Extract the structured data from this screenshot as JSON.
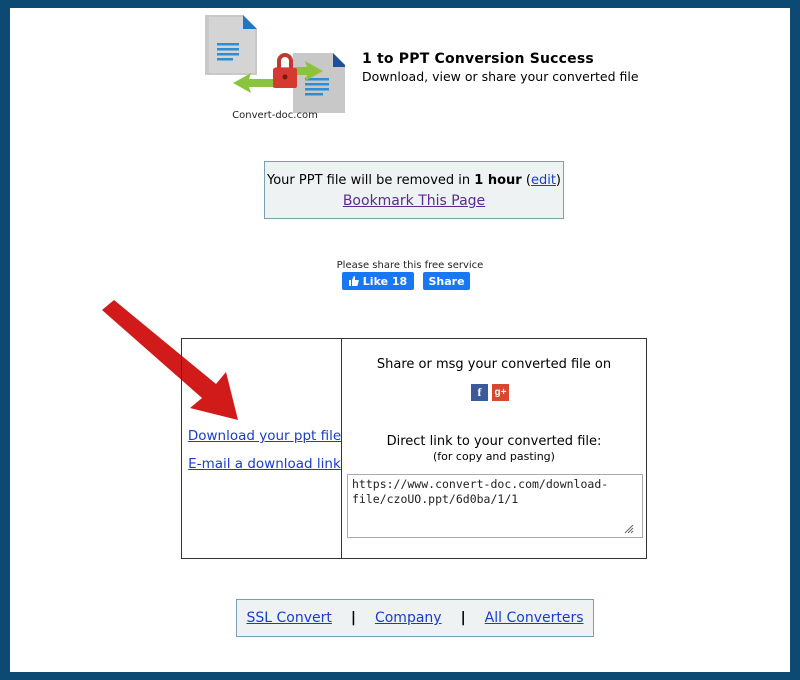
{
  "header": {
    "logo_caption": "Convert-doc.com",
    "title": "1 to PPT Conversion Success",
    "subtitle": "Download, view or share your converted file"
  },
  "info": {
    "prefix": "Your PPT file will be removed in",
    "duration": "1 hour",
    "open_paren": "(",
    "edit_label": "edit",
    "close_paren": ")",
    "bookmark_label": "Bookmark This Page"
  },
  "share_service": {
    "label": "Please share this free service",
    "like_label": "Like 18",
    "share_label": "Share"
  },
  "downloads": {
    "download_label": "Download your ppt file",
    "email_label": "E-mail a download link"
  },
  "share_panel": {
    "title": "Share or msg your converted file on",
    "facebook_glyph": "f",
    "gplus_glyph": "g+",
    "direct_title": "Direct link to your converted file:",
    "direct_sub": "(for copy and pasting)",
    "url": "https://www.convert-doc.com/download-file/czoUO.ppt/6d0ba/1/1"
  },
  "footer": {
    "items": [
      "SSL Convert",
      "Company",
      "All Converters"
    ],
    "separator": "|"
  },
  "colors": {
    "background_frame": "#0d4a73",
    "link": "#1a3ccc",
    "visited_link": "#5b2a8c",
    "facebook_button": "#1877f2",
    "arrow": "#d11a1a",
    "box_fill": "#eef2f3",
    "box_border": "#7a9fb0"
  },
  "icons": [
    "documents-lock-logo",
    "thumbs-up-icon",
    "facebook-icon",
    "google-plus-icon",
    "resize-grip-icon",
    "red-arrow"
  ]
}
